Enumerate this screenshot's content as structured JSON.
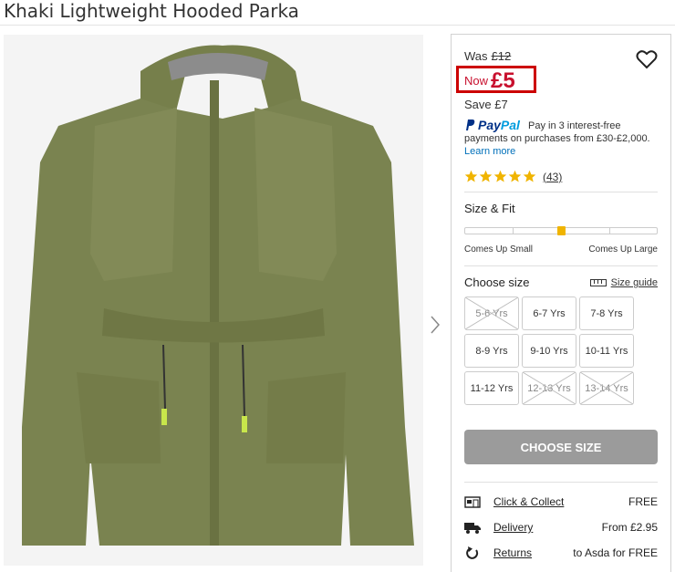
{
  "product": {
    "title": "Khaki Lightweight Hooded Parka"
  },
  "price": {
    "was_label": "Was",
    "was_value": "£12",
    "now_label": "Now",
    "now_value": "£5",
    "save_text": "Save £7"
  },
  "paypal": {
    "logo_a": "Pay",
    "logo_b": "Pal",
    "text": "Pay in 3 interest-free payments on purchases from £30-£2,000.",
    "learn_more": "Learn more"
  },
  "rating": {
    "stars": 5,
    "reviews": "(43)"
  },
  "size_fit": {
    "title": "Size & Fit",
    "small_label": "Comes Up Small",
    "large_label": "Comes Up Large",
    "position": 0.5
  },
  "sizes": {
    "label": "Choose size",
    "guide_label": "Size guide",
    "options": [
      {
        "label": "5-6 Yrs",
        "available": false
      },
      {
        "label": "6-7 Yrs",
        "available": true
      },
      {
        "label": "7-8 Yrs",
        "available": true
      },
      {
        "label": "8-9 Yrs",
        "available": true
      },
      {
        "label": "9-10 Yrs",
        "available": true
      },
      {
        "label": "10-11 Yrs",
        "available": true
      },
      {
        "label": "11-12 Yrs",
        "available": true
      },
      {
        "label": "12-13 Yrs",
        "available": false
      },
      {
        "label": "13-14 Yrs",
        "available": false
      }
    ]
  },
  "choose_button": "CHOOSE SIZE",
  "delivery": [
    {
      "icon": "store-icon",
      "label": "Click & Collect",
      "value": "FREE"
    },
    {
      "icon": "truck-icon",
      "label": "Delivery",
      "value": "From £2.95"
    },
    {
      "icon": "returns-icon",
      "label": "Returns",
      "value": "to Asda for FREE"
    }
  ],
  "colors": {
    "price_red": "#c8102e",
    "star": "#f0b400",
    "jacket": "#7a8350",
    "button_grey": "#9b9b9b"
  }
}
